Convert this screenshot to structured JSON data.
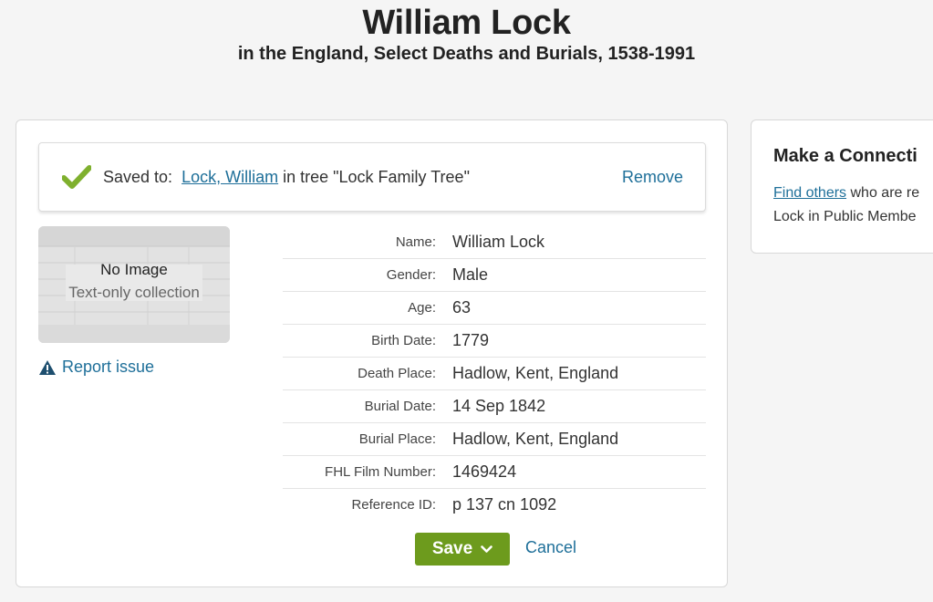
{
  "header": {
    "title": "William Lock",
    "subtitle": "in the England, Select Deaths and Burials, 1538-1991"
  },
  "saved": {
    "prefix": "Saved to:",
    "person_link": "Lock, William",
    "tree_text": "in tree \"Lock Family Tree\"",
    "remove_label": "Remove"
  },
  "thumbnail": {
    "title": "No Image",
    "subtitle": "Text-only collection"
  },
  "report_label": "Report issue",
  "details": [
    {
      "label": "Name:",
      "value": "William Lock"
    },
    {
      "label": "Gender:",
      "value": "Male"
    },
    {
      "label": "Age:",
      "value": "63"
    },
    {
      "label": "Birth Date:",
      "value": "1779"
    },
    {
      "label": "Death Place:",
      "value": "Hadlow, Kent, England"
    },
    {
      "label": "Burial Date:",
      "value": "14 Sep 1842"
    },
    {
      "label": "Burial Place:",
      "value": "Hadlow, Kent, England"
    },
    {
      "label": "FHL Film Number:",
      "value": "1469424"
    },
    {
      "label": "Reference ID:",
      "value": "p 137 cn 1092"
    }
  ],
  "actions": {
    "save_label": "Save",
    "cancel_label": "Cancel"
  },
  "side": {
    "title": "Make a Connecti",
    "link": "Find others",
    "line1_rest": " who are re",
    "line2": "Lock in Public Membe"
  },
  "colors": {
    "link": "#1e6f99",
    "save_button": "#6d9b1d",
    "check": "#7fb02e"
  }
}
